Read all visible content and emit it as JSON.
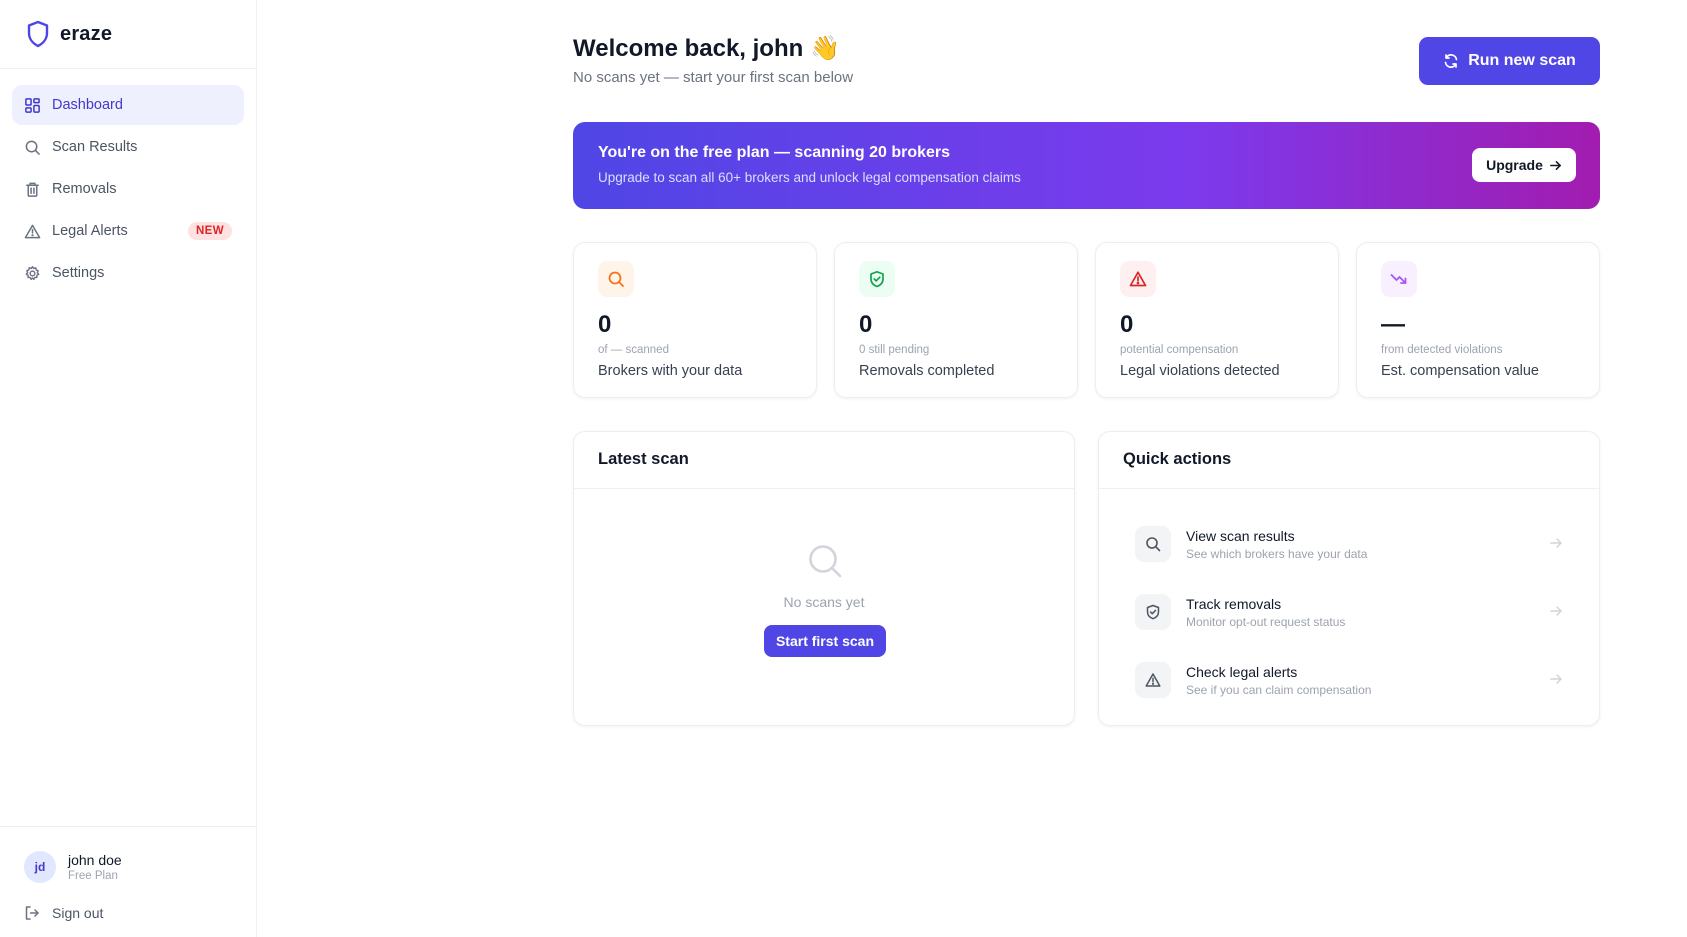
{
  "brand": {
    "name": "eraze",
    "accent": "#4f46e5"
  },
  "sidebar": {
    "items": [
      {
        "label": "Dashboard",
        "icon": "grid-icon",
        "active": true
      },
      {
        "label": "Scan Results",
        "icon": "search-icon"
      },
      {
        "label": "Removals",
        "icon": "trash-icon"
      },
      {
        "label": "Legal Alerts",
        "icon": "alert-triangle-icon",
        "badge": "NEW"
      },
      {
        "label": "Settings",
        "icon": "gear-icon"
      }
    ],
    "user": {
      "initials": "jd",
      "name": "john doe",
      "plan": "Free Plan"
    },
    "sign_out": "Sign out"
  },
  "header": {
    "welcome": "Welcome back, john 👋",
    "subtitle": "No scans yet — start your first scan below",
    "run_scan": "Run new scan"
  },
  "banner": {
    "title": "You're on the free plan — scanning 20 brokers",
    "subtitle": "Upgrade to scan all 60+ brokers and unlock legal compensation claims",
    "button": "Upgrade"
  },
  "stats": [
    {
      "icon": "search-icon",
      "value": "0",
      "note": "of — scanned",
      "label": "Brokers with your data",
      "color": "#f97316"
    },
    {
      "icon": "shield-check-icon",
      "value": "0",
      "note": "0 still pending",
      "label": "Removals completed",
      "color": "#16a34a"
    },
    {
      "icon": "alert-triangle-icon",
      "value": "0",
      "note": "potential compensation",
      "label": "Legal violations detected",
      "color": "#dc2626"
    },
    {
      "icon": "trending-down-icon",
      "value": "—",
      "note": "from detected violations",
      "label": "Est. compensation value",
      "color": "#a855f7"
    }
  ],
  "latest_scan": {
    "title": "Latest scan",
    "empty_text": "No scans yet",
    "button": "Start first scan"
  },
  "quick_actions": {
    "title": "Quick actions",
    "items": [
      {
        "icon": "search-icon",
        "title": "View scan results",
        "desc": "See which brokers have your data"
      },
      {
        "icon": "shield-check-icon",
        "title": "Track removals",
        "desc": "Monitor opt-out request status"
      },
      {
        "icon": "alert-triangle-icon",
        "title": "Check legal alerts",
        "desc": "See if you can claim compensation"
      }
    ]
  }
}
